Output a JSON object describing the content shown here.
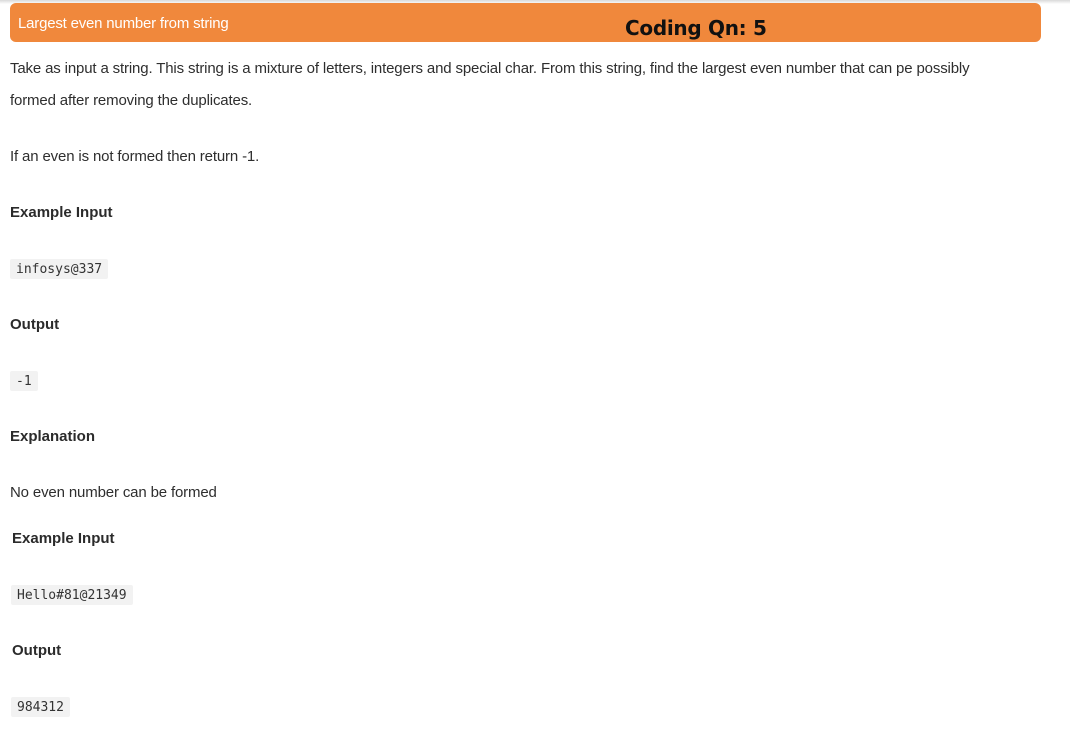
{
  "header": {
    "title": "Largest even number from string",
    "badge": "Coding Qn: 5"
  },
  "problem": {
    "line1": "Take as input a string. This string is a mixture of letters, integers and special char. From this string, find the largest even number that can pe possibly",
    "line2": "formed after removing the duplicates.",
    "note": "If an even is not formed then return -1."
  },
  "examples": [
    {
      "input_heading": "Example Input",
      "input": "infosys@337",
      "output_heading": "Output",
      "output": "-1",
      "explanation_heading": "Explanation",
      "explanation": "No even number can be formed"
    },
    {
      "input_heading": "Example Input",
      "input": "Hello#81@21349",
      "output_heading": "Output",
      "output": "984312"
    }
  ],
  "colors": {
    "header_bg": "#f0883c",
    "code_bg": "#f2f2f2"
  }
}
